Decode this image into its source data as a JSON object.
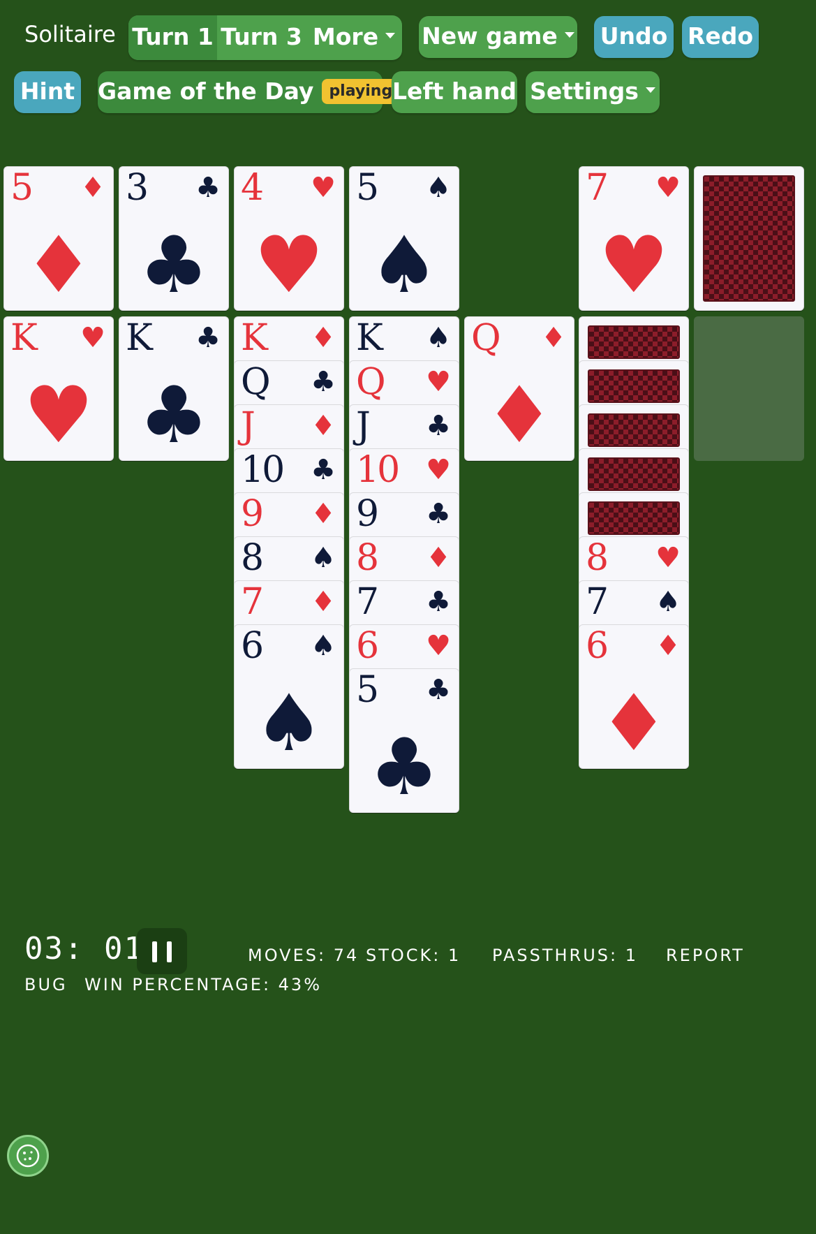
{
  "app_title": "Solitaire",
  "toolbar": {
    "turn1": "Turn 1",
    "turn3": "Turn 3",
    "more": "More",
    "new_game": "New game",
    "undo": "Undo",
    "redo": "Redo",
    "hint": "Hint",
    "game_of_day": "Game of the Day",
    "game_of_day_badge": "playing",
    "left_hand": "Left hand",
    "settings": "Settings"
  },
  "foundations": [
    {
      "rank": "5",
      "suit": "♦",
      "color": "red"
    },
    {
      "rank": "3",
      "suit": "♣",
      "color": "black"
    },
    {
      "rank": "4",
      "suit": "♥",
      "color": "red"
    },
    {
      "rank": "5",
      "suit": "♠",
      "color": "black"
    }
  ],
  "waste": {
    "rank": "7",
    "suit": "♥",
    "color": "red"
  },
  "tableau": {
    "col1": [
      {
        "rank": "K",
        "suit": "♥"
      }
    ],
    "col2": [
      {
        "rank": "K",
        "suit": "♣"
      }
    ],
    "col3": [
      {
        "rank": "K",
        "suit": "♦"
      },
      {
        "rank": "Q",
        "suit": "♣"
      },
      {
        "rank": "J",
        "suit": "♦"
      },
      {
        "rank": "10",
        "suit": "♣"
      },
      {
        "rank": "9",
        "suit": "♦"
      },
      {
        "rank": "8",
        "suit": "♠"
      },
      {
        "rank": "7",
        "suit": "♦"
      },
      {
        "rank": "6",
        "suit": "♠"
      }
    ],
    "col4": [
      {
        "rank": "K",
        "suit": "♠"
      },
      {
        "rank": "Q",
        "suit": "♥"
      },
      {
        "rank": "J",
        "suit": "♣"
      },
      {
        "rank": "10",
        "suit": "♥"
      },
      {
        "rank": "9",
        "suit": "♣"
      },
      {
        "rank": "8",
        "suit": "♦"
      },
      {
        "rank": "7",
        "suit": "♣"
      },
      {
        "rank": "6",
        "suit": "♥"
      },
      {
        "rank": "5",
        "suit": "♣"
      }
    ],
    "col5": [
      {
        "rank": "Q",
        "suit": "♦"
      }
    ],
    "col6_face_down_count": 5,
    "col6": [
      {
        "rank": "8",
        "suit": "♥"
      },
      {
        "rank": "7",
        "suit": "♠"
      },
      {
        "rank": "6",
        "suit": "♦"
      }
    ]
  },
  "status": {
    "timer": "03: 01",
    "moves": "MOVES: 74",
    "stock": "STOCK: 1",
    "passthrus": "PASSTHRUS: 1",
    "report": "REPORT",
    "bug": "BUG",
    "win_percentage": "WIN PERCENTAGE: 43%"
  },
  "colors": {
    "felt": "#25521a",
    "button_green": "#4ea14c",
    "button_blue": "#4aa7bd",
    "badge_yellow": "#f1c230",
    "card_red": "#e5333b",
    "card_black": "#0f1a38"
  }
}
